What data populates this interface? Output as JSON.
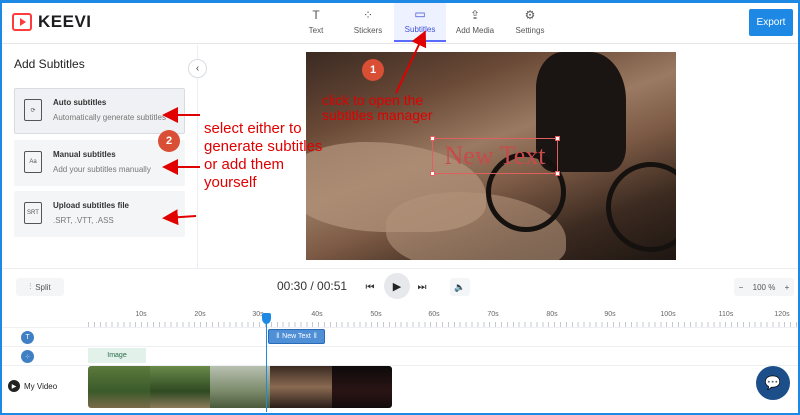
{
  "app": {
    "logo": "KEEVI"
  },
  "nav": {
    "items": [
      {
        "label": "Text",
        "icon": "T"
      },
      {
        "label": "Stickers",
        "icon": "⁘"
      },
      {
        "label": "Subtitles",
        "icon": "▭"
      },
      {
        "label": "Add Media",
        "icon": "⇪"
      },
      {
        "label": "Settings",
        "icon": "⚙"
      }
    ],
    "active": "Subtitles"
  },
  "export_label": "Export",
  "panel": {
    "title": "Add Subtitles",
    "options": [
      {
        "title": "Auto subtitles",
        "subtitle": "Automatically generate subtitles",
        "icon": "auto-subtitles-icon"
      },
      {
        "title": "Manual subtitles",
        "subtitle": "Add your subtitles manually",
        "icon": "manual-subtitles-icon",
        "icon_text": "Aa"
      },
      {
        "title": "Upload subtitles file",
        "subtitle": ".SRT, .VTT, .ASS",
        "icon": "upload-subtitles-icon",
        "icon_text": "SRT"
      }
    ]
  },
  "preview": {
    "overlay_text": "New Text"
  },
  "annotations": {
    "badge1": "1",
    "badge2": "2",
    "note1": "click to open the subtitles manager",
    "note2": "select either to generate subtitles or add them yourself"
  },
  "toolbar": {
    "split_label": "Split",
    "time": "00:30 / 00:51",
    "zoom_value": "100 %",
    "zoom_minus": "−",
    "zoom_plus": "+"
  },
  "timeline": {
    "ticks": [
      "10s",
      "20s",
      "30s",
      "40s",
      "50s",
      "60s",
      "70s",
      "80s",
      "90s",
      "100s",
      "110s",
      "120s"
    ],
    "text_clip_label": "New Text",
    "image_clip_label": "Image",
    "video_track_label": "My Video"
  },
  "colors": {
    "accent": "#1e88e5",
    "annotation": "#e00000",
    "badge": "#d84f35",
    "brand": "#ff3b3b"
  }
}
